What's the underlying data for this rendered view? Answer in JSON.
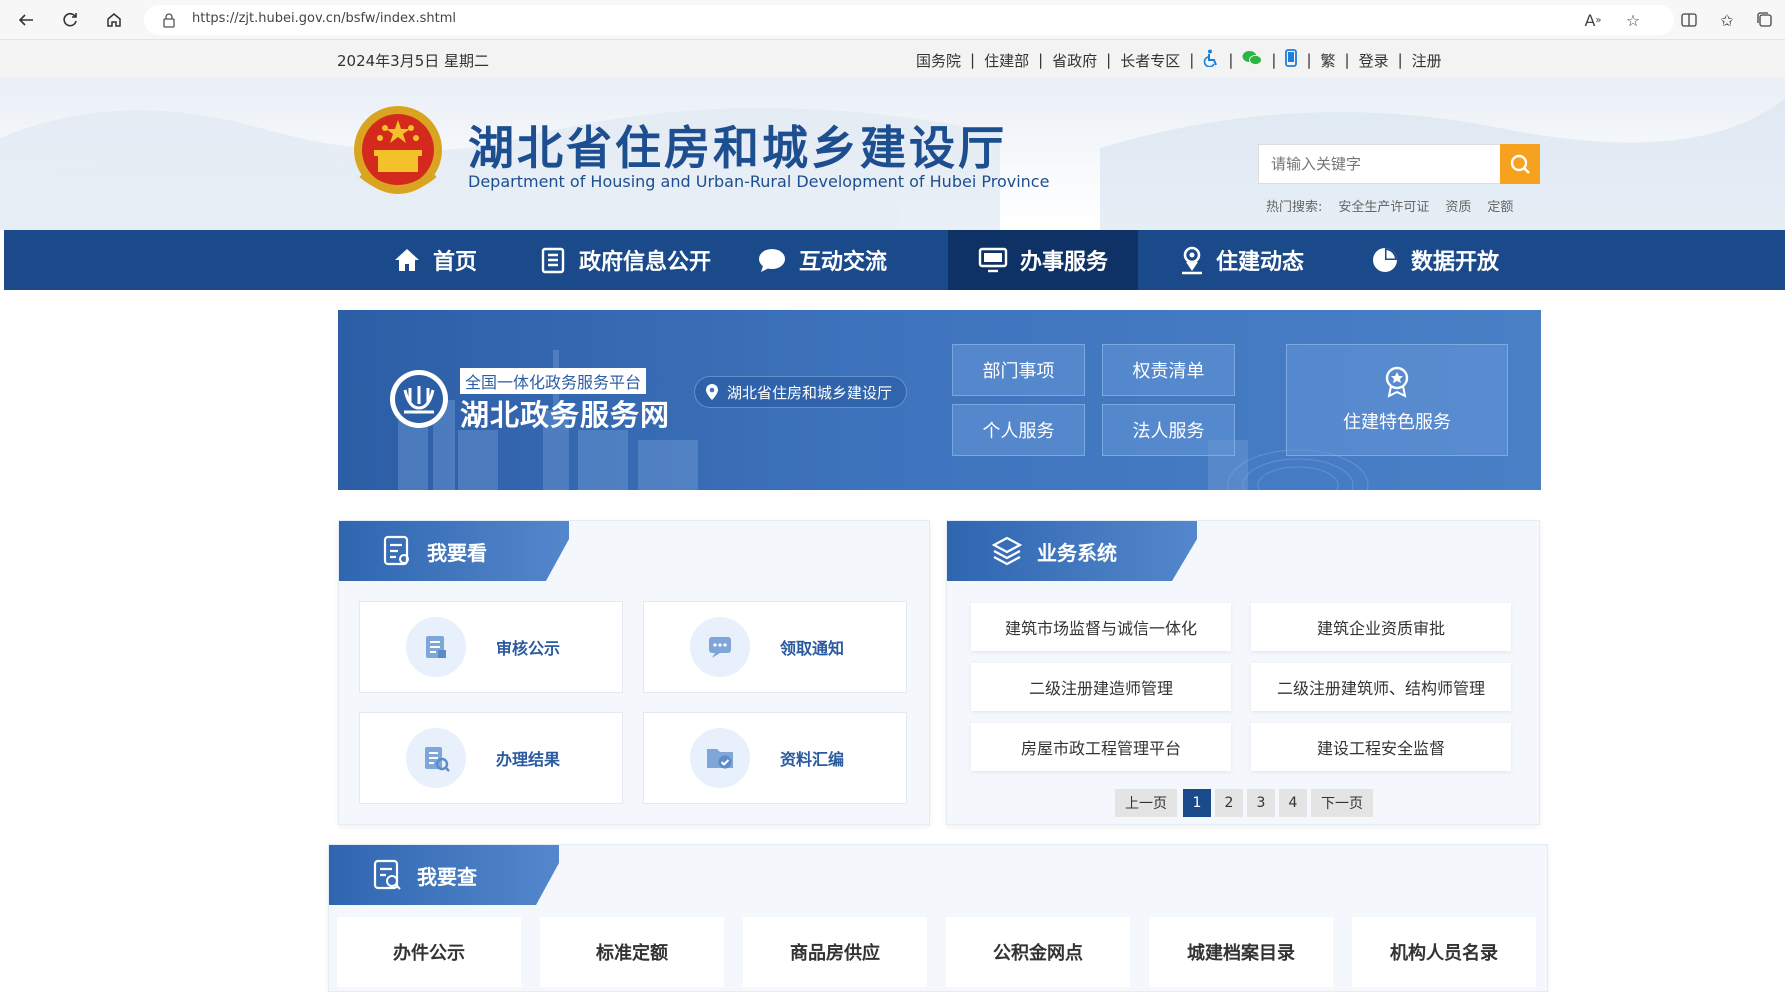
{
  "browser": {
    "url": "https://zjt.hubei.gov.cn/bsfw/index.shtml"
  },
  "topbar": {
    "date": "2024年3月5日 星期二",
    "links": [
      "国务院",
      "住建部",
      "省政府",
      "长者专区",
      "繁",
      "登录",
      "注册"
    ]
  },
  "header": {
    "title": "湖北省住房和城乡建设厅",
    "subtitle": "Department of Housing and Urban-Rural Development of Hubei Province",
    "search_placeholder": "请输入关键字",
    "hot_label": "热门搜索:",
    "hot_terms": [
      "安全生产许可证",
      "资质",
      "定额"
    ]
  },
  "nav": {
    "items": [
      "首页",
      "政府信息公开",
      "互动交流",
      "办事服务",
      "住建动态",
      "数据开放"
    ],
    "active": "办事服务"
  },
  "banner": {
    "tag": "全国一体化政务服务平台",
    "name": "湖北政务服务网",
    "location": "湖北省住房和城乡建设厅",
    "buttons": [
      "部门事项",
      "权责清单",
      "个人服务",
      "法人服务"
    ],
    "special": "住建特色服务"
  },
  "look": {
    "title": "我要看",
    "cards": [
      "审核公示",
      "领取通知",
      "办理结果",
      "资料汇编"
    ]
  },
  "systems": {
    "title": "业务系统",
    "items": [
      "建筑市场监督与诚信一体化",
      "建筑企业资质审批",
      "二级注册建造师管理",
      "二级注册建筑师、结构师管理",
      "房屋市政工程管理平台",
      "建设工程安全监督"
    ],
    "pagination": {
      "prev": "上一页",
      "pages": [
        "1",
        "2",
        "3",
        "4"
      ],
      "next": "下一页",
      "current": "1"
    }
  },
  "query": {
    "title": "我要查",
    "items": [
      "办件公示",
      "标准定额",
      "商品房供应",
      "公积金网点",
      "城建档案目录",
      "机构人员名录"
    ]
  },
  "colors": {
    "nav_bg": "#1b4a8a",
    "nav_active": "#0e3166",
    "search_btn": "#f6a21e",
    "title": "#1d4e8f"
  }
}
